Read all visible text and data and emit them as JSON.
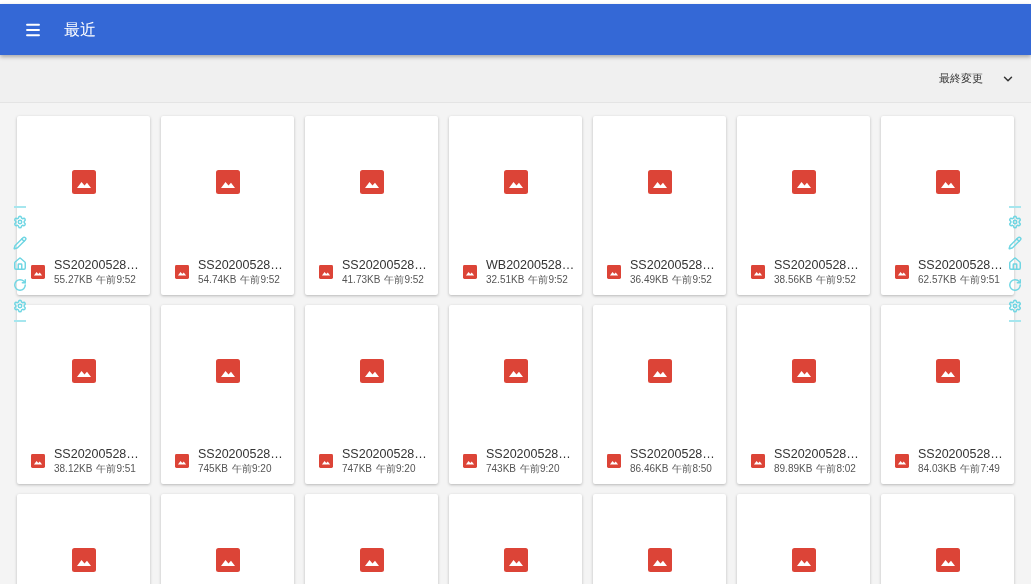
{
  "app_bar": {
    "title": "最近"
  },
  "sort": {
    "label": "最終変更"
  },
  "files": [
    {
      "kind": "full",
      "name": "SS20200528…",
      "size": "55.27KB",
      "time": "午前9:52"
    },
    {
      "kind": "full",
      "name": "SS20200528…",
      "size": "54.74KB",
      "time": "午前9:52"
    },
    {
      "kind": "full",
      "name": "SS20200528…",
      "size": "41.73KB",
      "time": "午前9:52"
    },
    {
      "kind": "full",
      "name": "WB20200528…",
      "size": "32.51KB",
      "time": "午前9:52"
    },
    {
      "kind": "full",
      "name": "SS20200528…",
      "size": "36.49KB",
      "time": "午前9:52"
    },
    {
      "kind": "full",
      "name": "SS20200528…",
      "size": "38.56KB",
      "time": "午前9:52"
    },
    {
      "kind": "full",
      "name": "SS20200528…",
      "size": "62.57KB",
      "time": "午前9:51"
    },
    {
      "kind": "full",
      "name": "SS20200528…",
      "size": "38.12KB",
      "time": "午前9:51"
    },
    {
      "kind": "full",
      "name": "SS20200528…",
      "size": "745KB",
      "time": "午前9:20"
    },
    {
      "kind": "full",
      "name": "SS20200528…",
      "size": "747KB",
      "time": "午前9:20"
    },
    {
      "kind": "full",
      "name": "SS20200528…",
      "size": "743KB",
      "time": "午前9:20"
    },
    {
      "kind": "full",
      "name": "SS20200528…",
      "size": "86.46KB",
      "time": "午前8:50"
    },
    {
      "kind": "full",
      "name": "SS20200528…",
      "size": "89.89KB",
      "time": "午前8:02"
    },
    {
      "kind": "full",
      "name": "SS20200528…",
      "size": "84.03KB",
      "time": "午前7:49"
    },
    {
      "kind": "cut"
    },
    {
      "kind": "cut"
    },
    {
      "kind": "cut"
    },
    {
      "kind": "cut"
    },
    {
      "kind": "cut"
    },
    {
      "kind": "cut"
    },
    {
      "kind": "cut"
    }
  ]
}
